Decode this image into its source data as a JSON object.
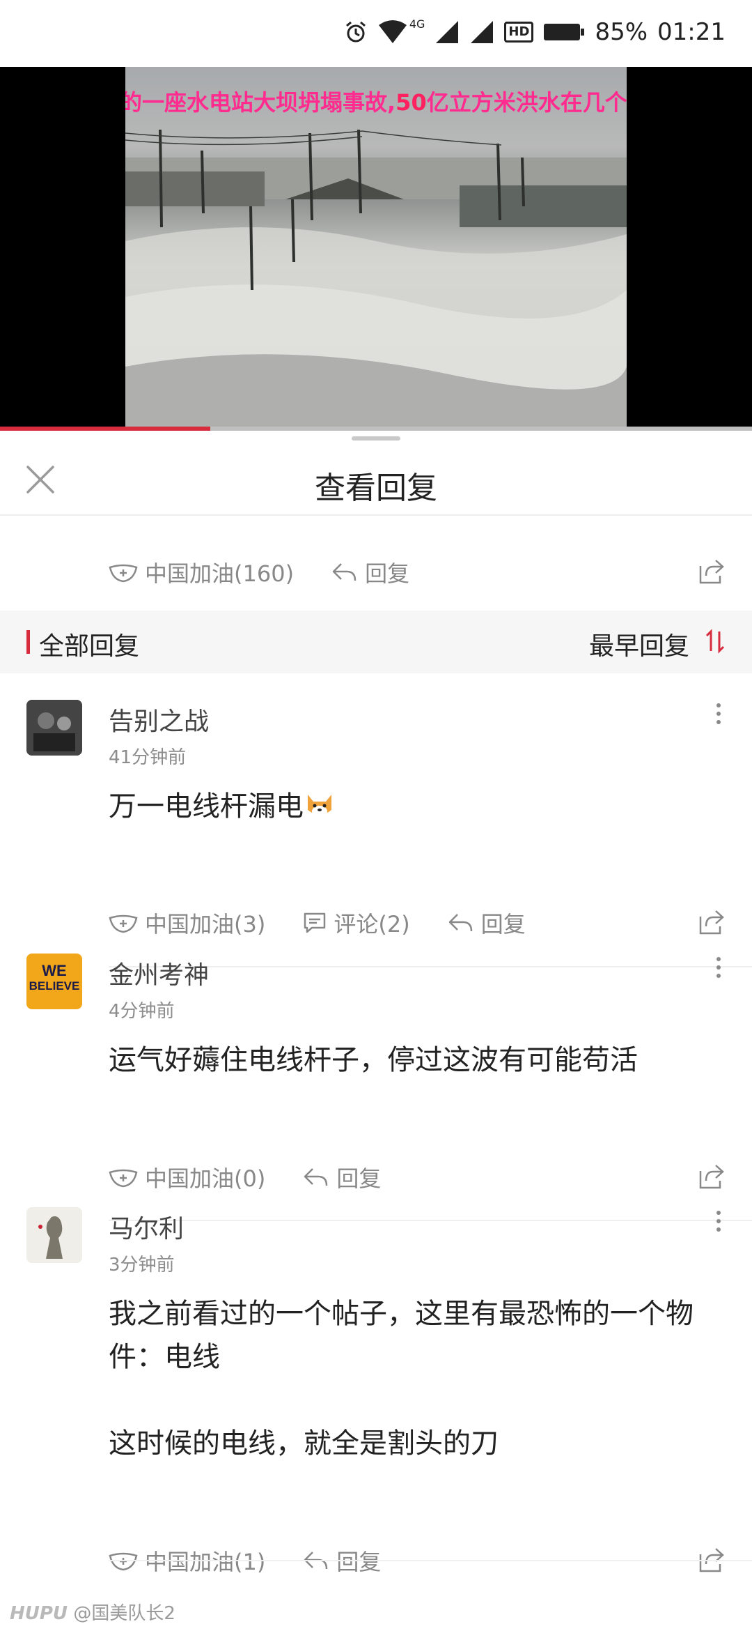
{
  "status": {
    "battery": "85%",
    "time": "01:21",
    "network": "4G",
    "hd": "HD"
  },
  "video": {
    "caption_pre": "的一座水电站大坝坍塌事故,",
    "caption_bold": "50",
    "caption_post": "亿立方米洪水在几个",
    "progress": 0.28
  },
  "sheet": {
    "title": "查看回复"
  },
  "main_post": {
    "like_label": "中国加油(160)",
    "reply_label": "回复"
  },
  "section": {
    "title": "全部回复",
    "sort_label": "最早回复"
  },
  "comments": [
    {
      "username": "告别之战",
      "time": "41分钟前",
      "text": "万一电线杆漏电",
      "like_label": "中国加油(3)",
      "comment_label": "评论(2)",
      "reply_label": "回复",
      "avatar": "dark-photo"
    },
    {
      "username": "金州考神",
      "time": "4分钟前",
      "text": "运气好薅住电线杆子，停过这波有可能苟活",
      "like_label": "中国加油(0)",
      "reply_label": "回复",
      "avatar": "we-believe",
      "avatar_text": [
        "WE",
        "BELIEVE"
      ]
    },
    {
      "username": "马尔利",
      "time": "3分钟前",
      "text_lines": [
        "我之前看过的一个帖子，这里有最恐怖的一个物",
        "件：电线",
        "",
        "这时候的电线，就全是割头的刀"
      ],
      "like_label": "中国加油(1)",
      "reply_label": "回复",
      "avatar": "sketch"
    }
  ],
  "footer": {
    "brand": "HUPU",
    "user": "@国美队长2"
  },
  "colors": {
    "accent": "#d62c3d",
    "muted": "#888888",
    "section_bg": "#f6f6f6"
  }
}
